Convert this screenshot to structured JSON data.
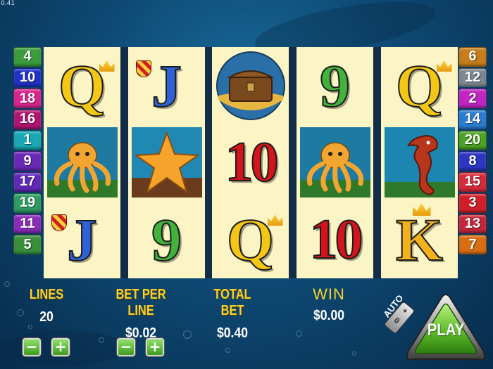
{
  "version": "0.41",
  "line_numbers": {
    "left": [
      {
        "n": "4",
        "color": "#3a9c3a"
      },
      {
        "n": "10",
        "color": "#2030c9"
      },
      {
        "n": "18",
        "color": "#d8248e"
      },
      {
        "n": "16",
        "color": "#b0156f"
      },
      {
        "n": "1",
        "color": "#1aa9b4"
      },
      {
        "n": "9",
        "color": "#6b29b8"
      },
      {
        "n": "17",
        "color": "#6228b8"
      },
      {
        "n": "19",
        "color": "#2f9c63"
      },
      {
        "n": "11",
        "color": "#8a2bb9"
      },
      {
        "n": "5",
        "color": "#3a8f3a"
      }
    ],
    "right": [
      {
        "n": "6",
        "color": "#c77d1a"
      },
      {
        "n": "12",
        "color": "#7f8892"
      },
      {
        "n": "2",
        "color": "#c125c2"
      },
      {
        "n": "14",
        "color": "#2a7dd1"
      },
      {
        "n": "20",
        "color": "#4da323"
      },
      {
        "n": "8",
        "color": "#2e37c4"
      },
      {
        "n": "15",
        "color": "#d82a3a"
      },
      {
        "n": "3",
        "color": "#d11f2a"
      },
      {
        "n": "13",
        "color": "#c7263a"
      },
      {
        "n": "7",
        "color": "#d86d12"
      }
    ]
  },
  "reels": [
    [
      "Q",
      "octopus",
      "J"
    ],
    [
      "J",
      "starfish",
      "9"
    ],
    [
      "treasure-chest",
      "10",
      "Q"
    ],
    [
      "9",
      "octopus",
      "10"
    ],
    [
      "Q",
      "seahorse",
      "K"
    ]
  ],
  "panel": {
    "lines_label": "LINES",
    "lines_value": "20",
    "bet_label": "BET PER LINE",
    "bet_value": "$0.02",
    "total_label": "TOTAL BET",
    "total_value": "$0.40",
    "win_label": "WIN",
    "win_value": "$0.00",
    "minus": "−",
    "plus": "+"
  },
  "controls": {
    "auto_label": "AUTO",
    "play_label": "PLAY",
    "toggle_on": "+",
    "toggle_off": "0"
  }
}
